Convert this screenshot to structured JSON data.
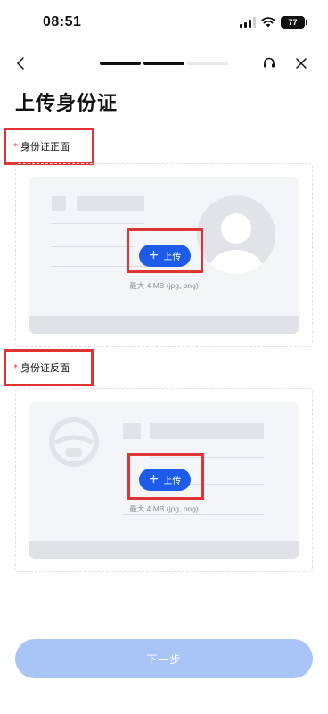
{
  "status_bar": {
    "time": "08:51",
    "battery": "77"
  },
  "nav": {
    "progress_total": 3,
    "progress_done": 2
  },
  "page": {
    "title": "上传身份证"
  },
  "front": {
    "required_mark": "*",
    "label": "身份证正面",
    "upload_label": "上传",
    "hint": "最大 4 MB (jpg, png)"
  },
  "back": {
    "required_mark": "*",
    "label": "身份证反面",
    "upload_label": "上传",
    "hint": "最大 4 MB (jpg, png)"
  },
  "footer": {
    "next_label": "下一步"
  },
  "colors": {
    "accent": "#1c5ce8",
    "required": "#e03434",
    "disabled_button": "#a9c4f7"
  },
  "icons": [
    "signal-icon",
    "wifi-icon",
    "battery-icon",
    "back-arrow-icon",
    "headset-icon",
    "close-icon",
    "plus-icon",
    "avatar-icon",
    "emblem-icon"
  ]
}
